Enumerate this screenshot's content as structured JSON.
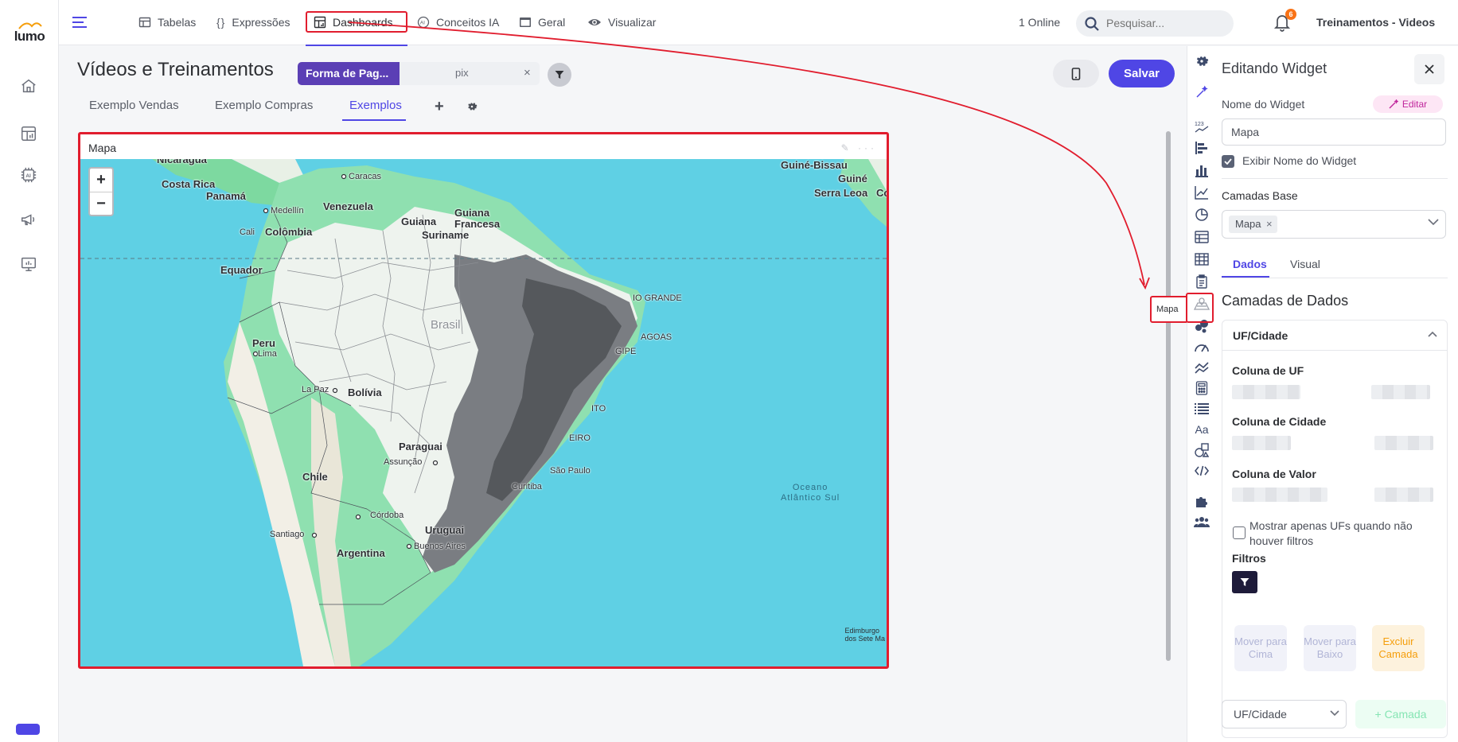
{
  "app": {
    "logo_text": "lumo",
    "online": "1 Online",
    "company": "Treinamentos - Videos",
    "notifications": "6"
  },
  "nav": [
    {
      "label": "Tabelas",
      "icon": "table-icon"
    },
    {
      "label": "Expressões",
      "icon": "braces-icon"
    },
    {
      "label": "Dashboards",
      "icon": "dashboard-icon"
    },
    {
      "label": "Conceitos IA",
      "icon": "ai-icon"
    },
    {
      "label": "Geral",
      "icon": "window-icon"
    },
    {
      "label": "Visualizar",
      "icon": "eye-icon"
    }
  ],
  "search": {
    "placeholder": "Pesquisar..."
  },
  "dashboard": {
    "title": "Vídeos e Treinamentos",
    "filter": {
      "label": "Forma de Pag...",
      "value": "pix",
      "close": "×"
    },
    "save_label": "Salvar",
    "tabs": [
      "Exemplo Vendas",
      "Exemplo Compras",
      "Exemplos"
    ],
    "active_tab": "Exemplos",
    "add_tab": "+"
  },
  "widget": {
    "title": "Mapa",
    "actions": "✎ ···",
    "zoom_in": "+",
    "zoom_out": "−",
    "labels": {
      "nicaragua": "Nicaragua",
      "costa_rica": "Costa Rica",
      "panama": "Panamá",
      "caracas": "Caracas",
      "venezuela": "Venezuela",
      "medellin": "Medellín",
      "guiana": "Guiana",
      "guiana_francesa": "Guiana\nFrancesa",
      "suriname": "Suriname",
      "cali": "Cali",
      "colombia": "Colômbia",
      "equador": "Equador",
      "brasil": "Brasil",
      "peru": "Peru",
      "lima": "Lima",
      "la_paz": "La Paz",
      "bolivia": "Bolívia",
      "paraguai": "Paraguai",
      "assuncao": "Assunção",
      "chile": "Chile",
      "cordoba": "Córdoba",
      "santiago": "Santiago",
      "uruguai": "Uruguai",
      "buenos_aires": "Buenos Aires",
      "argentina": "Argentina",
      "sao_paulo": "São Paulo",
      "curitiba": "Curitiba",
      "guine_bissau": "Guiné-Bissau",
      "guine": "Guiné",
      "serra_leoa": "Serra Leoa",
      "oceano": "Oceano\nAtlântico Sul",
      "rio_grande": "IO GRANDE",
      "alagoas": "AGOAS",
      "sergipe": "GIPE",
      "ito": "ITO",
      "eiro": "EIRO",
      "ce": "Co",
      "attribution": "Edimburgo\ndos Sete Ma"
    }
  },
  "tooltip": {
    "label": "Mapa"
  },
  "panel": {
    "title": "Editando Widget",
    "widget_name_label": "Nome do Widget",
    "edit_label": "Editar",
    "widget_name_value": "Mapa",
    "show_name_label": "Exibir Nome do Widget",
    "base_layers_label": "Camadas Base",
    "base_layer_chip": "Mapa",
    "tabs": [
      "Dados",
      "Visual"
    ],
    "active_tab": "Dados",
    "data_layers_title": "Camadas de Dados",
    "accordion_title": "UF/Cidade",
    "uf_column_label": "Coluna de UF",
    "city_column_label": "Coluna de Cidade",
    "value_column_label": "Coluna de Valor",
    "only_uf_label": "Mostrar apenas UFs quando não houver filtros",
    "filters_label": "Filtros",
    "move_up": "Mover para Cima",
    "move_down": "Mover para Baixo",
    "delete_layer": "Excluir Camada",
    "layer_type": "UF/Cidade",
    "add_layer": "+ Camada"
  }
}
